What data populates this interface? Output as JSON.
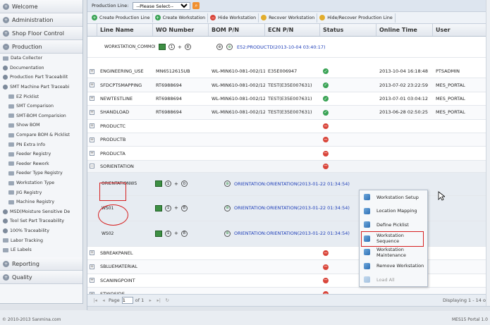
{
  "sidebar": {
    "sections_top": [
      {
        "label": "Welcome"
      },
      {
        "label": "Administration"
      },
      {
        "label": "Shop Floor Control"
      },
      {
        "label": "Production"
      }
    ],
    "production_items": [
      {
        "label": "Data Collector",
        "level": 1,
        "kind": "page"
      },
      {
        "label": "Documentation",
        "level": 1,
        "kind": "group"
      },
      {
        "label": "Production Part Traceabilit",
        "level": 1,
        "kind": "group"
      },
      {
        "label": "SMT Machine Part Traceabi",
        "level": 1,
        "kind": "group"
      },
      {
        "label": "EZ Picklist",
        "level": 2
      },
      {
        "label": "SMT Comparison",
        "level": 2
      },
      {
        "label": "SMT-BOM Comparision",
        "level": 2
      },
      {
        "label": "Show BOM",
        "level": 2
      },
      {
        "label": "Compare BOM & Picklist",
        "level": 2
      },
      {
        "label": "PN Extra Info",
        "level": 2
      },
      {
        "label": "Feeder Registry",
        "level": 2
      },
      {
        "label": "Feeder Rework",
        "level": 2
      },
      {
        "label": "Feeder Type Registry",
        "level": 2
      },
      {
        "label": "Workstation Type",
        "level": 2
      },
      {
        "label": "JIG Registry",
        "level": 2
      },
      {
        "label": "Machine Registry",
        "level": 2
      },
      {
        "label": "MSD(Moisture Sensitive De",
        "level": 1,
        "kind": "group"
      },
      {
        "label": "Tool Set Part Traceability",
        "level": 1,
        "kind": "group"
      },
      {
        "label": "100% Traceability",
        "level": 1,
        "kind": "group"
      },
      {
        "label": "Labor Tracking",
        "level": 1,
        "kind": "page"
      },
      {
        "label": "LE Labels",
        "level": 1,
        "kind": "page"
      }
    ],
    "sections_bottom": [
      {
        "label": "Reporting"
      },
      {
        "label": "Quality"
      }
    ]
  },
  "filter": {
    "label": "Production Line:",
    "selected": "--Please Select--"
  },
  "toolbar": [
    {
      "label": "Create Production Line",
      "icon": "add-icon",
      "color": "g"
    },
    {
      "label": "Create Workstation",
      "icon": "add-icon",
      "color": "g"
    },
    {
      "label": "Hide Workstation",
      "icon": "remove-icon",
      "color": "r"
    },
    {
      "label": "Recover Workstation",
      "icon": "recover-icon",
      "color": "y"
    },
    {
      "label": "Hide/Recover Production Line",
      "icon": "recover-icon",
      "color": "y"
    }
  ],
  "columns": [
    "Line Name",
    "WO Number",
    "BOM P/N",
    "ECN P/N",
    "Status",
    "Online Time",
    "User"
  ],
  "rows_top": [
    {
      "name": "ENGINEERING_USE",
      "wo": "MN6512615UB",
      "bom": "WL-MIN610-081-002/11",
      "ecn": "E35E006947",
      "status": "ok",
      "time": "2013-10-04 16:18:48",
      "user": "PTSADMIN"
    },
    {
      "name": "SFDCPTSMAPPING",
      "wo": "RT6988694",
      "bom": "WL-MIN610-081-002/12",
      "ecn": "TEST(E35E007631)",
      "status": "ok",
      "time": "2013-07-02 23:22:59",
      "user": "MES_PORTAL"
    },
    {
      "name": "NEWTESTLINE",
      "wo": "RT6988694",
      "bom": "WL-MIN610-081-002/12",
      "ecn": "TEST(E35E007631)",
      "status": "ok",
      "time": "2013-07-01 03:04:12",
      "user": "MES_PORTAL"
    },
    {
      "name": "SHANDLOAD",
      "wo": "RT6988694",
      "bom": "WL-MIN610-081-002/12",
      "ecn": "TEST(E35E007631)",
      "status": "ok",
      "time": "2013-06-28 02:50:25",
      "user": "MES_PORTAL"
    },
    {
      "name": "PRODUCTC",
      "wo": "",
      "bom": "",
      "ecn": "",
      "status": "no",
      "time": "",
      "user": ""
    },
    {
      "name": "PRODUCTB",
      "wo": "",
      "bom": "",
      "ecn": "",
      "status": "no",
      "time": "",
      "user": ""
    },
    {
      "name": "PRODUCTA",
      "wo": "",
      "bom": "",
      "ecn": "",
      "status": "no",
      "time": "",
      "user": ""
    }
  ],
  "workstation_common": {
    "name": "WORKSTATION_COMMON",
    "seq1": "1",
    "plus": "+",
    "seq2": "8",
    "link": "E52:PRODUCTD(2013-10-04 03:40:17)"
  },
  "group": {
    "name": "SORIENTATION",
    "status": "no"
  },
  "detail_rows": [
    {
      "name": "ORIENTATIONWS",
      "seq1": "1",
      "plus": "+",
      "seq2": "0",
      "link": "ORIENTATION:ORIENTATION(2013-01-22 01:34:54)"
    },
    {
      "name": "WS01",
      "seq1": "1",
      "plus": "+",
      "seq2": "8",
      "link": "ORIENTATION:ORIENTATION(2013-01-22 01:34:54)"
    },
    {
      "name": "WS02",
      "seq1": "1",
      "plus": "+",
      "seq2": "8",
      "link": "ORIENTATION:ORIENTATION(2013-01-22 01:34:54)"
    }
  ],
  "rows_bottom": [
    {
      "name": "SBREAKPANEL",
      "status": "no"
    },
    {
      "name": "SBLUEMATERIAL",
      "status": "no"
    },
    {
      "name": "SCANINGPOINT",
      "status": "no"
    },
    {
      "name": "STWOSIDE",
      "status": "no"
    },
    {
      "name": "CTESTLINE",
      "status": "no"
    }
  ],
  "context_menu": [
    {
      "label": "Workstation Setup",
      "enabled": true
    },
    {
      "label": "Location Mapping",
      "enabled": true
    },
    {
      "label": "Define Picklist",
      "enabled": true
    },
    {
      "label": "Workstation Sequence",
      "enabled": true,
      "highlighted": true
    },
    {
      "label": "Workstation Maintenance",
      "enabled": true
    },
    {
      "label": "Remove Workstation",
      "enabled": true
    },
    {
      "label": "Load All",
      "enabled": false
    }
  ],
  "pager": {
    "page_label": "Page",
    "page": "1",
    "of_label": "of 1",
    "display": "Displaying 1 - 14 o"
  },
  "footer": {
    "left": "© 2010-2013 Sanmina.com",
    "right": "MES15 Portal 1.0"
  }
}
